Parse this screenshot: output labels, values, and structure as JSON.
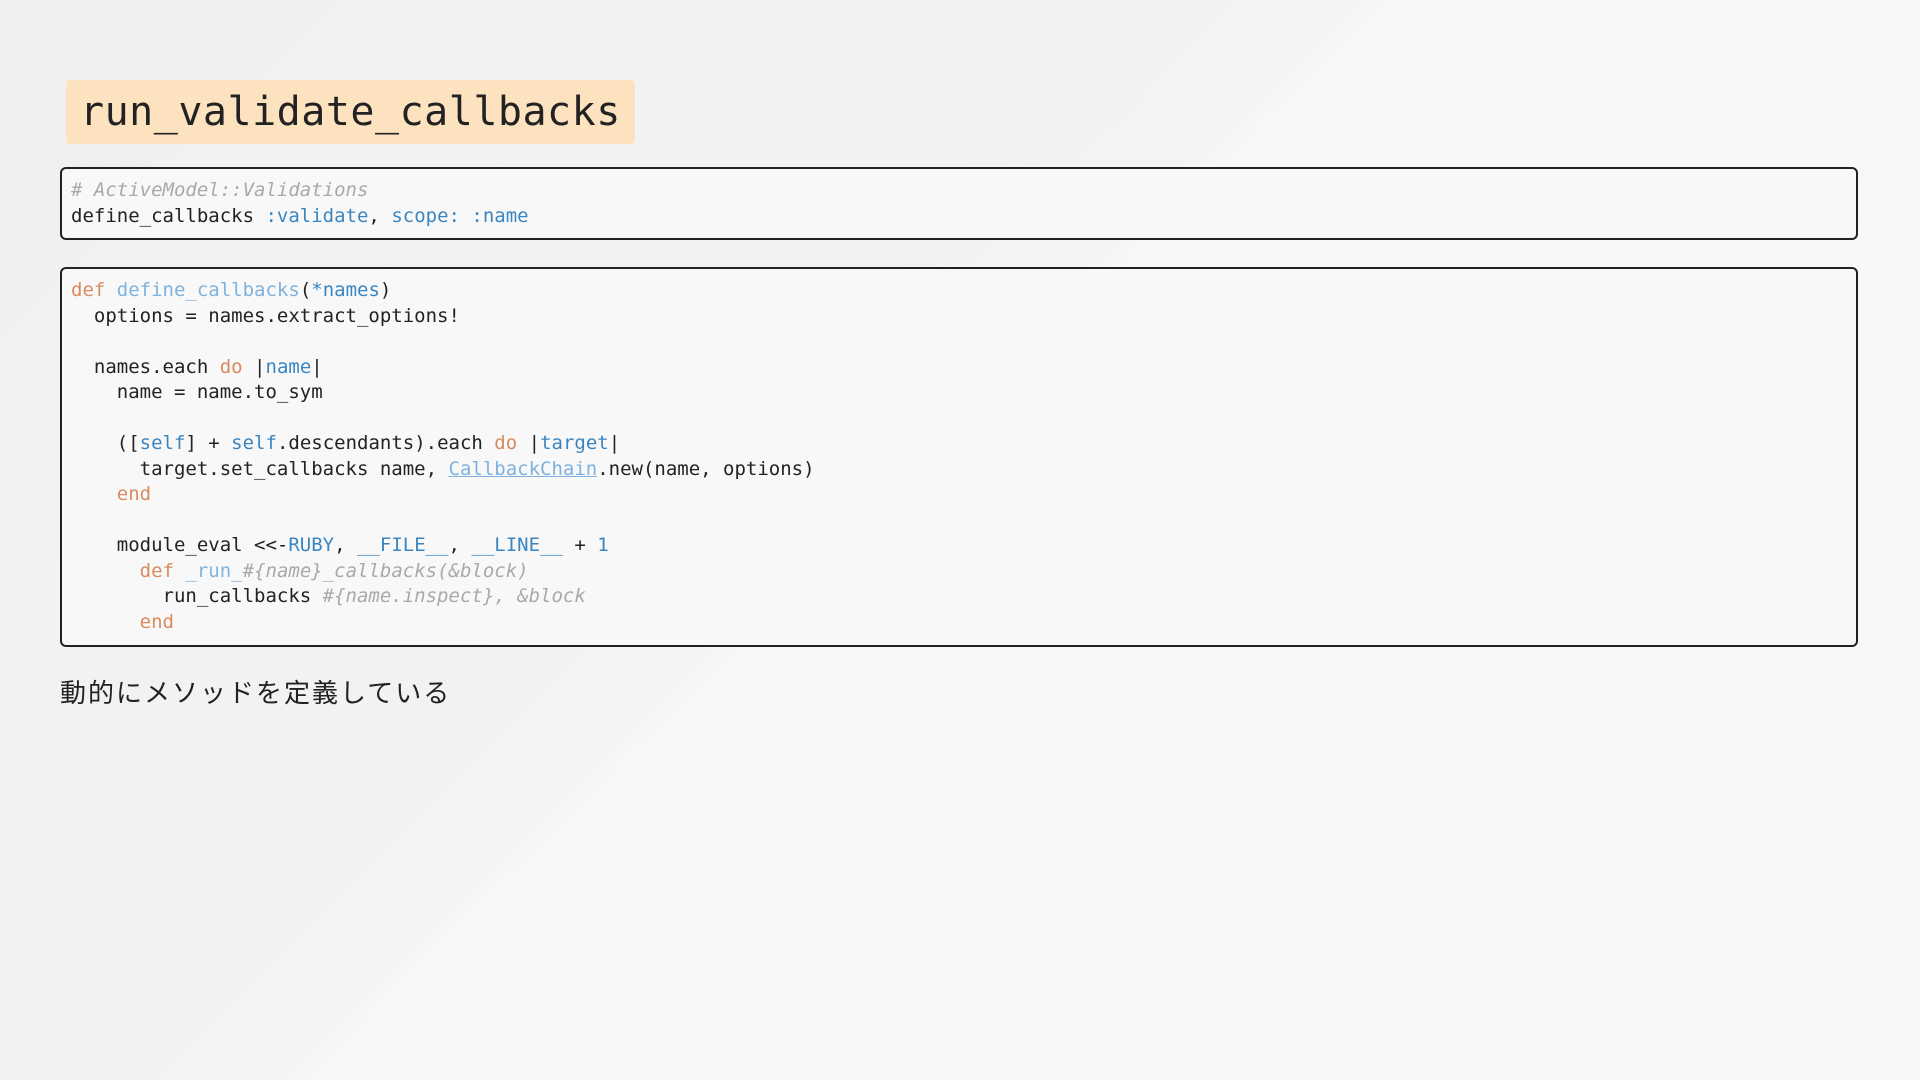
{
  "title": "run_validate_callbacks",
  "block1": [
    [
      {
        "t": "# ActiveModel::Validations",
        "c": "tk-comment"
      }
    ],
    [
      {
        "t": "define_callbacks "
      },
      {
        "t": ":validate",
        "c": "tk-sym"
      },
      {
        "t": ", "
      },
      {
        "t": "scope:",
        "c": "tk-sym"
      },
      {
        "t": " "
      },
      {
        "t": ":name",
        "c": "tk-sym"
      }
    ]
  ],
  "block2": [
    [
      {
        "t": "def",
        "c": "tk-kw"
      },
      {
        "t": " "
      },
      {
        "t": "define_callbacks",
        "c": "tk-fn"
      },
      {
        "t": "("
      },
      {
        "t": "*names",
        "c": "tk-var"
      },
      {
        "t": ")"
      }
    ],
    [
      {
        "t": "  options = names.extract_options!"
      }
    ],
    [
      {
        "t": ""
      }
    ],
    [
      {
        "t": "  names.each "
      },
      {
        "t": "do",
        "c": "tk-kw"
      },
      {
        "t": " |"
      },
      {
        "t": "name",
        "c": "tk-var"
      },
      {
        "t": "|"
      }
    ],
    [
      {
        "t": "    name = name.to_sym"
      }
    ],
    [
      {
        "t": ""
      }
    ],
    [
      {
        "t": "    (["
      },
      {
        "t": "self",
        "c": "tk-var"
      },
      {
        "t": "] + "
      },
      {
        "t": "self",
        "c": "tk-var"
      },
      {
        "t": ".descendants).each "
      },
      {
        "t": "do",
        "c": "tk-kw"
      },
      {
        "t": " |"
      },
      {
        "t": "target",
        "c": "tk-var"
      },
      {
        "t": "|"
      }
    ],
    [
      {
        "t": "      target.set_callbacks name, "
      },
      {
        "t": "CallbackChain",
        "c": "tk-link"
      },
      {
        "t": ".new(name, options)"
      }
    ],
    [
      {
        "t": "    "
      },
      {
        "t": "end",
        "c": "tk-kw"
      }
    ],
    [
      {
        "t": ""
      }
    ],
    [
      {
        "t": "    module_eval <<-"
      },
      {
        "t": "RUBY",
        "c": "tk-var"
      },
      {
        "t": ", "
      },
      {
        "t": "__FILE__",
        "c": "tk-var"
      },
      {
        "t": ", "
      },
      {
        "t": "__LINE__",
        "c": "tk-var"
      },
      {
        "t": " + "
      },
      {
        "t": "1",
        "c": "tk-var"
      }
    ],
    [
      {
        "t": "      "
      },
      {
        "t": "def",
        "c": "tk-kw"
      },
      {
        "t": " "
      },
      {
        "t": "_run_",
        "c": "tk-fn"
      },
      {
        "t": "#{name}_callbacks(&block)",
        "c": "tk-interp"
      }
    ],
    [
      {
        "t": "        run_callbacks "
      },
      {
        "t": "#{name.inspect}, &block",
        "c": "tk-interp"
      }
    ],
    [
      {
        "t": "      "
      },
      {
        "t": "end",
        "c": "tk-kw"
      }
    ]
  ],
  "caption": "動的にメソッドを定義している"
}
